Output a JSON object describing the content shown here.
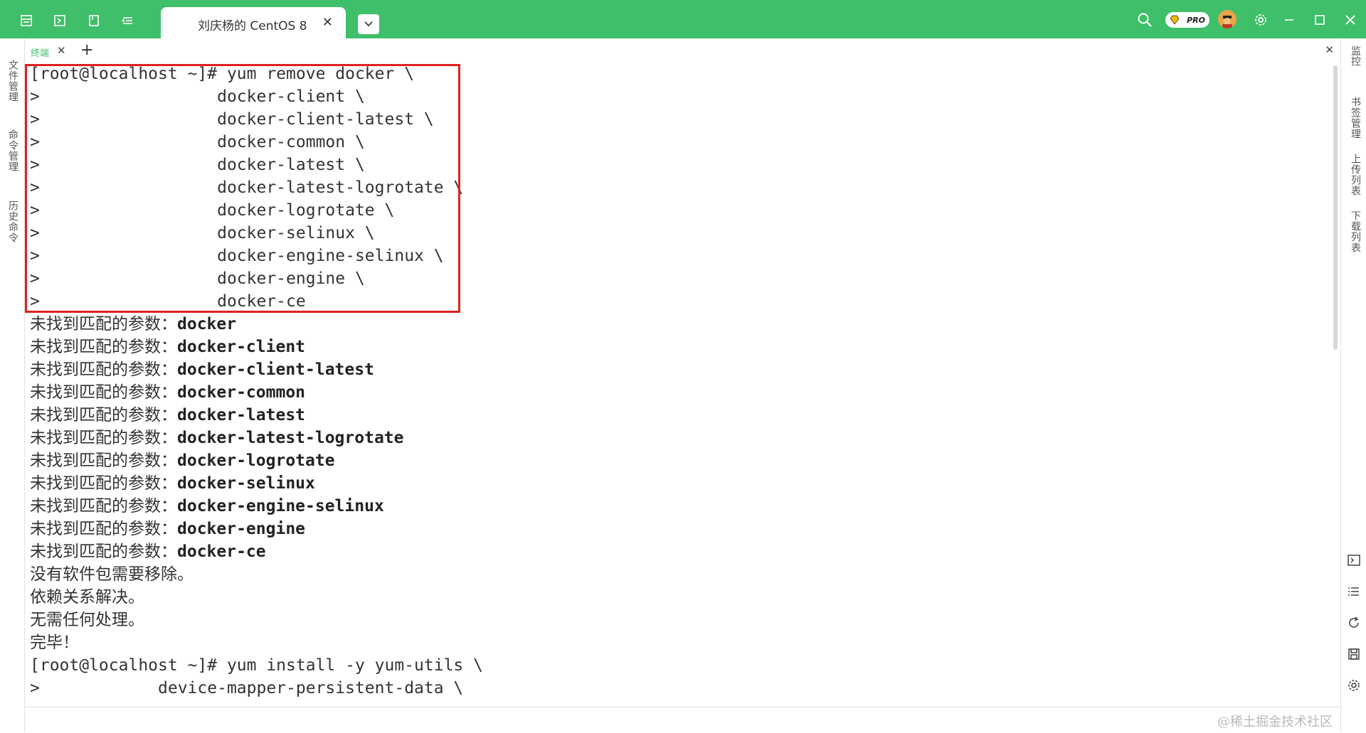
{
  "window": {
    "tab_title": "刘庆杨的 CentOS 8",
    "tab_close": "✕",
    "dropdown": "⌄",
    "pro_label": "PRO"
  },
  "colors": {
    "accent": "#3fbf6a",
    "highlight": "#e02020",
    "text": "#333333"
  },
  "left_sidebar": {
    "items": [
      "文件管理",
      "命令管理",
      "历史命令"
    ]
  },
  "right_sidebar": {
    "items": [
      "监控",
      "书签管理",
      "上传列表",
      "下载列表"
    ]
  },
  "terminal_tabs": {
    "active": "终端",
    "close": "✕",
    "add": "+",
    "close_all": "✕"
  },
  "terminal": {
    "remove_block": [
      "[root@localhost ~]# yum remove docker \\",
      ">                  docker-client \\",
      ">                  docker-client-latest \\",
      ">                  docker-common \\",
      ">                  docker-latest \\",
      ">                  docker-latest-logrotate \\",
      ">                  docker-logrotate \\",
      ">                  docker-selinux \\",
      ">                  docker-engine-selinux \\",
      ">                  docker-engine \\",
      ">                  docker-ce"
    ],
    "not_found_prefix": "未找到匹配的参数：",
    "not_found_args": [
      "docker",
      "docker-client",
      "docker-client-latest",
      "docker-common",
      "docker-latest",
      "docker-latest-logrotate",
      "docker-logrotate",
      "docker-selinux",
      "docker-engine-selinux",
      "docker-engine",
      "docker-ce"
    ],
    "messages": [
      "没有软件包需要移除。",
      "依赖关系解决。",
      "无需任何处理。",
      "完毕！"
    ],
    "install_block": [
      "[root@localhost ~]# yum install -y yum-utils \\",
      ">            device-mapper-persistent-data \\"
    ]
  },
  "watermark": "@稀土掘金技术社区"
}
